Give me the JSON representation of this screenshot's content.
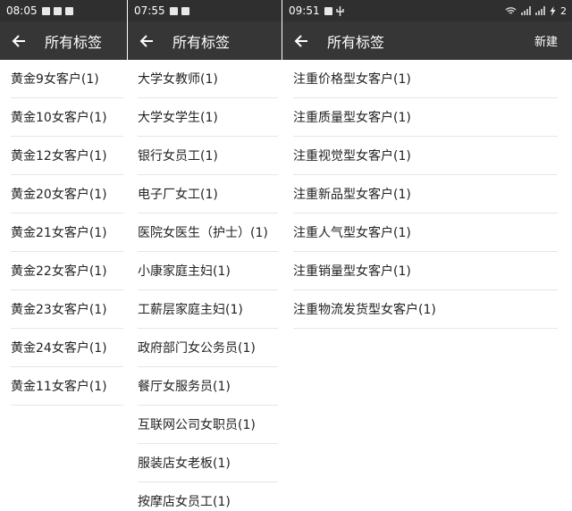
{
  "screens": [
    {
      "status_time": "08:05",
      "title": "所有标签",
      "tags": [
        "黄金9女客户(1)",
        "黄金10女客户(1)",
        "黄金12女客户(1)",
        "黄金20女客户(1)",
        "黄金21女客户(1)",
        "黄金22女客户(1)",
        "黄金23女客户(1)",
        "黄金24女客户(1)",
        "黄金11女客户(1)"
      ]
    },
    {
      "status_time": "07:55",
      "title": "所有标签",
      "tags": [
        "大学女教师(1)",
        "大学女学生(1)",
        "银行女员工(1)",
        "电子厂女工(1)",
        "医院女医生（护士）(1)",
        "小康家庭主妇(1)",
        "工薪层家庭主妇(1)",
        "政府部门女公务员(1)",
        "餐厅女服务员(1)",
        "互联网公司女职员(1)",
        "服装店女老板(1)",
        "按摩店女员工(1)"
      ]
    },
    {
      "status_time": "09:51",
      "status_right_text": "2",
      "title": "所有标签",
      "new_label": "新建",
      "tags": [
        "注重价格型女客户(1)",
        "注重质量型女客户(1)",
        "注重视觉型女客户(1)",
        "注重新品型女客户(1)",
        "注重人气型女客户(1)",
        "注重销量型女客户(1)",
        "注重物流发货型女客户(1)"
      ]
    }
  ],
  "icons": [
    "image-icon",
    "mail-icon",
    "notification-icon",
    "usb-icon",
    "wifi-icon",
    "signal-icon",
    "charging-icon",
    "back-arrow-icon"
  ],
  "colors": {
    "status_bar": "#2f2f2f",
    "app_bar": "#363636",
    "divider": "#e6e6e6",
    "text": "#222222"
  }
}
